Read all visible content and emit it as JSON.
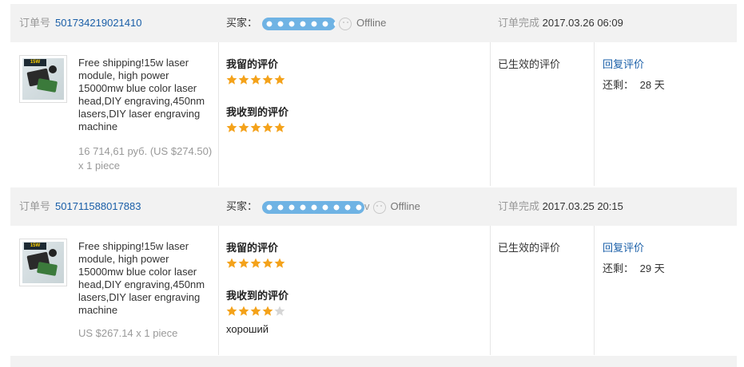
{
  "labels": {
    "order_no": "订单号",
    "buyer": "买家：",
    "offline": "Offline",
    "completed": "订单完成",
    "my_feedback": "我留的评价",
    "received_feedback": "我收到的评价",
    "status": "已生效的评价",
    "reply": "回复评价",
    "remain_prefix": "还剩：",
    "remain_unit": "天"
  },
  "colors": {
    "link": "#1a5fa8",
    "star_on": "#f4a21a",
    "star_off": "#d6d6d6",
    "header_bg": "#f2f2f2"
  },
  "orders": [
    {
      "number": "501734219021410",
      "buyer_suffix": "",
      "completed_at": "2017.03.26 06:09",
      "product": {
        "thumb_label": "15W",
        "title": "Free shipping!15w laser module, high power 15000mw blue color laser head,DIY engraving,450nm lasers,DIY laser engraving machine",
        "price": "16 714,61 руб. (US $274.50) x 1 piece"
      },
      "my_rating": 5,
      "received_rating": 5,
      "received_comment": "",
      "days_left": "28"
    },
    {
      "number": "501711588017883",
      "buyer_suffix": "v",
      "completed_at": "2017.03.25 20:15",
      "product": {
        "thumb_label": "15W",
        "title": "Free shipping!15w laser module, high power 15000mw blue color laser head,DIY engraving,450nm lasers,DIY laser engraving machine",
        "price": "US $267.14 x 1 piece"
      },
      "my_rating": 5,
      "received_rating": 4,
      "received_comment": "хороший",
      "days_left": "29"
    }
  ]
}
